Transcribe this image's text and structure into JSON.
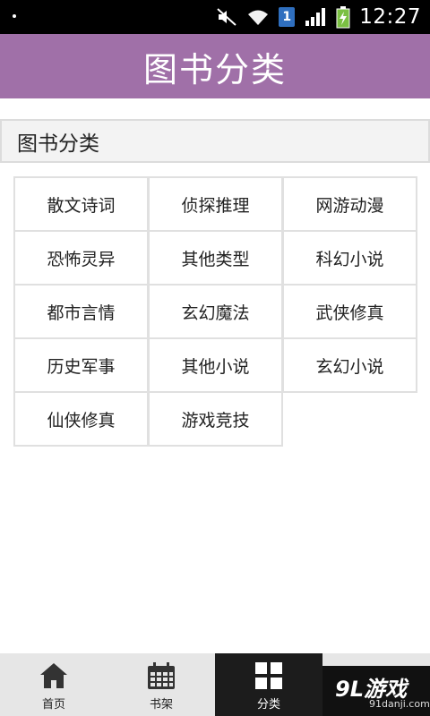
{
  "status_bar": {
    "time": "12:27",
    "sim_badge": "1",
    "icons": [
      "notification-dot-icon",
      "mute-icon",
      "wifi-icon",
      "sim-icon",
      "signal-icon",
      "battery-charging-icon"
    ]
  },
  "title_bar": {
    "title": "图书分类"
  },
  "section": {
    "title": "图书分类"
  },
  "categories": [
    "散文诗词",
    "侦探推理",
    "网游动漫",
    "恐怖灵异",
    "其他类型",
    "科幻小说",
    "都市言情",
    "玄幻魔法",
    "武侠修真",
    "历史军事",
    "其他小说",
    "玄幻小说",
    "仙侠修真",
    "游戏竞技"
  ],
  "tabs": [
    {
      "label": "首页",
      "icon": "home-icon"
    },
    {
      "label": "书架",
      "icon": "calendar-icon"
    },
    {
      "label": "分类",
      "icon": "grid-icon",
      "active": true
    }
  ],
  "watermark": {
    "logo": "9L游戏",
    "url": "91danji.com"
  },
  "colors": {
    "title_bar": "#a070a8",
    "tab_bar": "#e6e6e6",
    "active_tab": "#1c1c1c"
  }
}
